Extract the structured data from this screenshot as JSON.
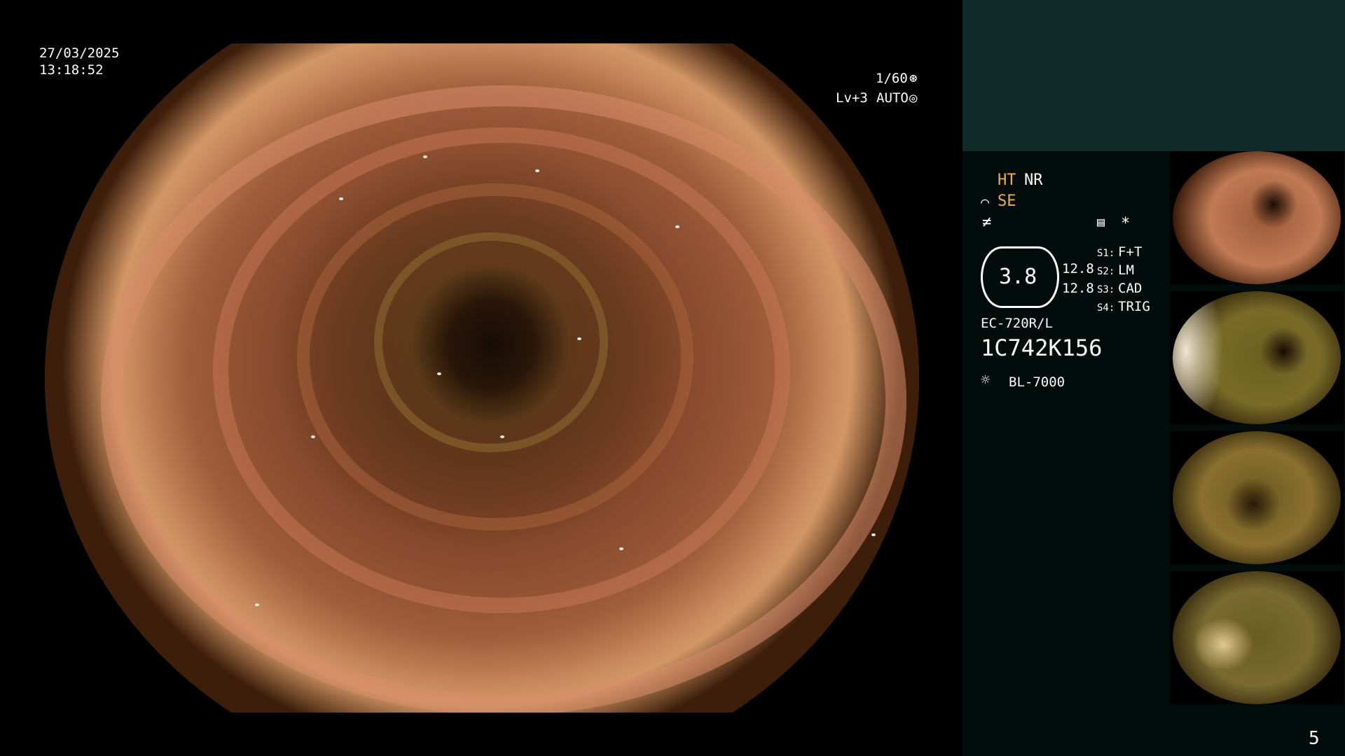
{
  "overlay": {
    "date": "27/03/2025",
    "time": "13:18:52",
    "shutter": "1/60",
    "level": "Lv+3",
    "iris": "AUTO"
  },
  "panel": {
    "ht": "HT",
    "nr": "NR",
    "se": "SE",
    "star": "*",
    "gauge_value": "3.8",
    "readout_1": "12.8",
    "readout_2": "12.8",
    "s1": "F+T",
    "s2": "LM",
    "s3": "CAD",
    "s4": "TRIG",
    "s1_label": "S1:",
    "s2_label": "S2:",
    "s3_label": "S3:",
    "s4_label": "S4:",
    "scope_model": "EC-720R/L",
    "serial": "1C742K156",
    "light_source": "BL-7000",
    "page_number": "5"
  },
  "colors": {
    "panel_bg": "#020c0b",
    "panel_header": "#0e2b28",
    "highlight": "#f0b040"
  }
}
